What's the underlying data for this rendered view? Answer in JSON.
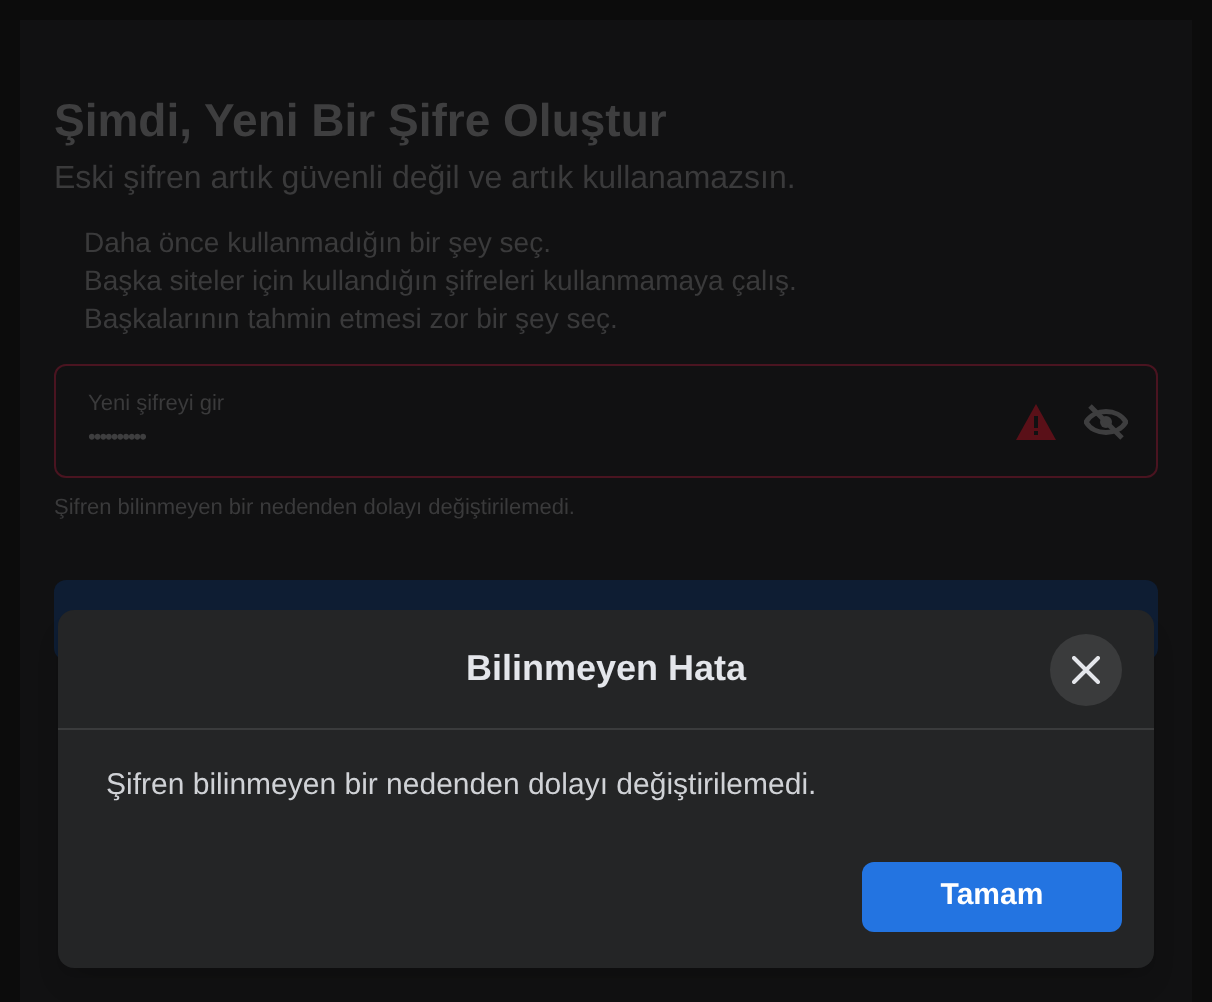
{
  "page": {
    "title": "Şimdi, Yeni Bir Şifre Oluştur",
    "subtitle": "Eski şifren artık güvenli değil ve artık kullanamazsın.",
    "tips": [
      "Daha önce kullanmadığın bir şey seç.",
      "Başka siteler için kullandığın şifreleri kullanmamaya çalış.",
      "Başkalarının tahmin etmesi zor bir şey seç."
    ],
    "password_field": {
      "label": "Yeni şifreyi gir",
      "value": "••••••••••",
      "error": true
    },
    "error_text": "Şifren bilinmeyen bir nedenden dolayı değiştirilemedi."
  },
  "dialog": {
    "title": "Bilinmeyen Hata",
    "message": "Şifren bilinmeyen bir nedenden dolayı değiştirilemedi.",
    "button": "Tamam"
  }
}
